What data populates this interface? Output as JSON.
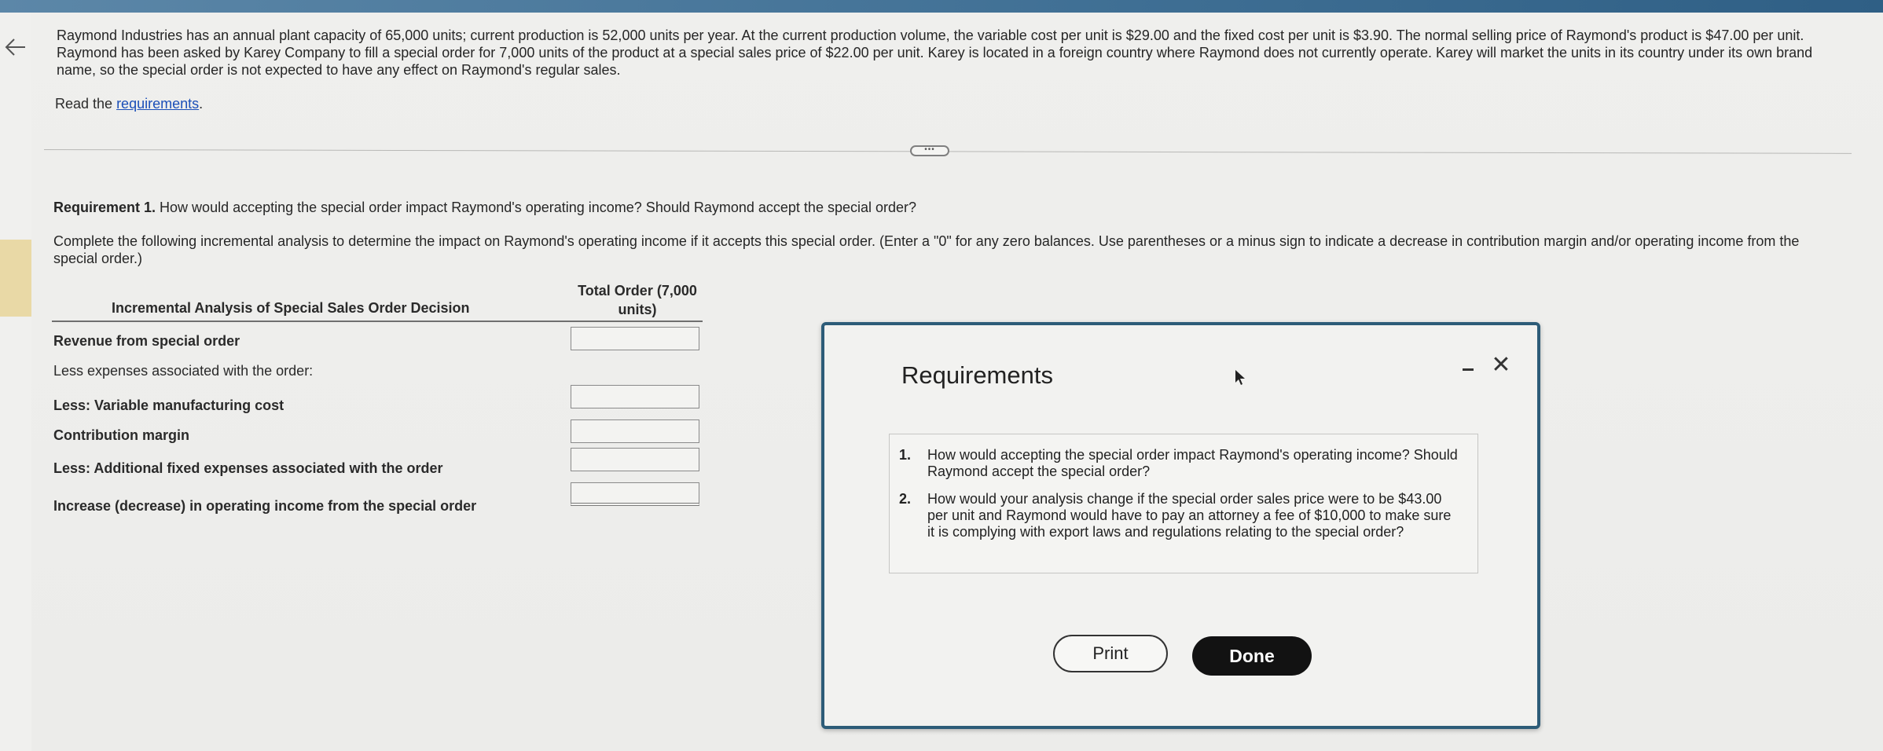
{
  "problem": {
    "intro": "Raymond Industries has an annual plant capacity of 65,000 units; current production is 52,000 units per year. At the current production volume, the variable cost per unit is $29.00 and the fixed cost per unit is $3.90. The normal selling price of Raymond's product is $47.00 per unit. Raymond has been asked by Karey Company to fill a special order for 7,000 units of the product at a special sales price of $22.00 per unit. Karey is located in a foreign country where Raymond does not currently operate. Karey will market the units in its country under its own brand name, so the special order is not expected to have any effect on Raymond's regular sales.",
    "read_prefix": "Read the ",
    "read_link": "requirements",
    "read_suffix": "."
  },
  "question": {
    "req_label": "Requirement 1.",
    "req_text": " How would accepting the special order impact Raymond's operating income? Should Raymond accept the special order?",
    "instructions": "Complete the following incremental analysis to determine the impact on Raymond's operating income if it accepts this special order. (Enter a \"0\" for any zero balances. Use parentheses or a minus sign to indicate a decrease in contribution margin and/or operating income from the special order.)"
  },
  "table": {
    "title": "Incremental Analysis of Special Sales Order Decision",
    "column_line1": "Total Order (7,000",
    "column_line2": "units)",
    "rows": [
      "Revenue from special order",
      "Less expenses associated with the order:",
      "Less: Variable manufacturing cost",
      "Contribution margin",
      "Less: Additional fixed expenses associated with the order",
      "Increase (decrease) in operating income from the special order"
    ]
  },
  "modal": {
    "title": "Requirements",
    "minimize_icon": "minimize-icon",
    "close_glyph": "✕",
    "items": [
      {
        "num": "1.",
        "text": "How would accepting the special order impact Raymond's operating income? Should Raymond accept the special order?"
      },
      {
        "num": "2.",
        "text": "How would your analysis change if the special order sales price were to be $43.00 per unit and Raymond would have to pay an attorney a fee of $10,000 to make sure it is complying with export laws and regulations relating to the special order?"
      }
    ],
    "print_label": "Print",
    "done_label": "Done"
  },
  "controls": {
    "expand_glyph": "•••",
    "back_icon": "arrow-left-icon"
  },
  "colors": {
    "link": "#1b4fb8",
    "modal_border": "#2d5c78",
    "done_bg": "#121212"
  }
}
